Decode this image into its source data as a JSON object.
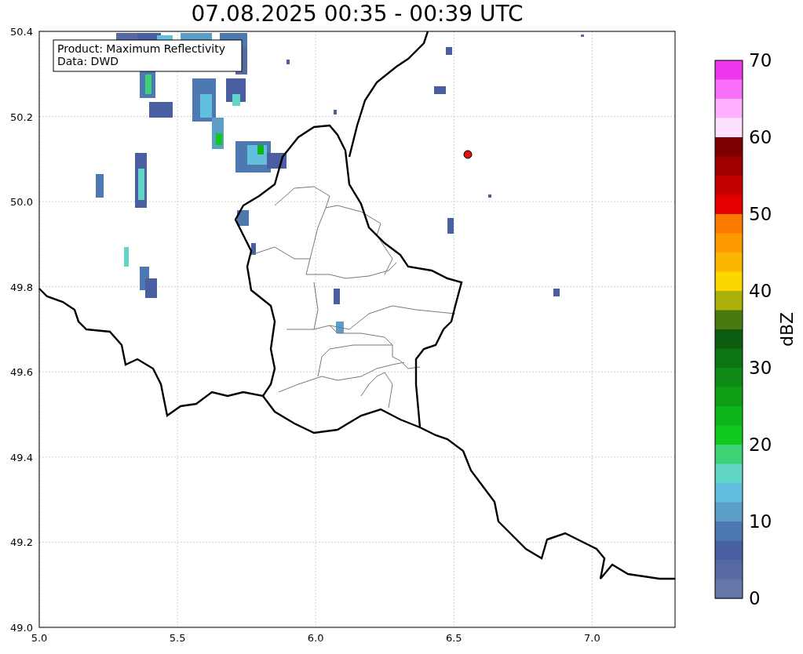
{
  "title": "07.08.2025 00:35 - 00:39 UTC",
  "map": {
    "info_box": [
      "Product: Maximum Reflectivity",
      "Data: DWD"
    ],
    "xticks": [
      "5.0",
      "5.5",
      "6.0",
      "6.5",
      "7.0"
    ],
    "yticks": [
      "50.4",
      "50.2",
      "50.0",
      "49.8",
      "49.6",
      "49.4",
      "49.2",
      "49.0"
    ]
  },
  "colorbar": {
    "label": "dBZ",
    "ticks": [
      "70",
      "60",
      "50",
      "40",
      "30",
      "20",
      "10",
      "0"
    ],
    "segments": [
      {
        "color": "#ee36ee"
      },
      {
        "color": "#fa70fa"
      },
      {
        "color": "#ffb0ff"
      },
      {
        "color": "#ffe0ff"
      },
      {
        "color": "#7d0000"
      },
      {
        "color": "#a00000"
      },
      {
        "color": "#c30000"
      },
      {
        "color": "#e50000"
      },
      {
        "color": "#fd7a00"
      },
      {
        "color": "#fd9a00"
      },
      {
        "color": "#fdb600"
      },
      {
        "color": "#fdd600"
      },
      {
        "color": "#adaf0b"
      },
      {
        "color": "#4a7a0f"
      },
      {
        "color": "#0b5e10"
      },
      {
        "color": "#0d7413"
      },
      {
        "color": "#0d8a14"
      },
      {
        "color": "#0f9f16"
      },
      {
        "color": "#0fb61b"
      },
      {
        "color": "#11c81e"
      },
      {
        "color": "#3ed276"
      },
      {
        "color": "#62d6c6"
      },
      {
        "color": "#62bfdd"
      },
      {
        "color": "#5b9ec8"
      },
      {
        "color": "#4e78b0"
      },
      {
        "color": "#4a5fa1"
      },
      {
        "color": "#5669a3"
      },
      {
        "color": "#6577a9"
      }
    ]
  }
}
